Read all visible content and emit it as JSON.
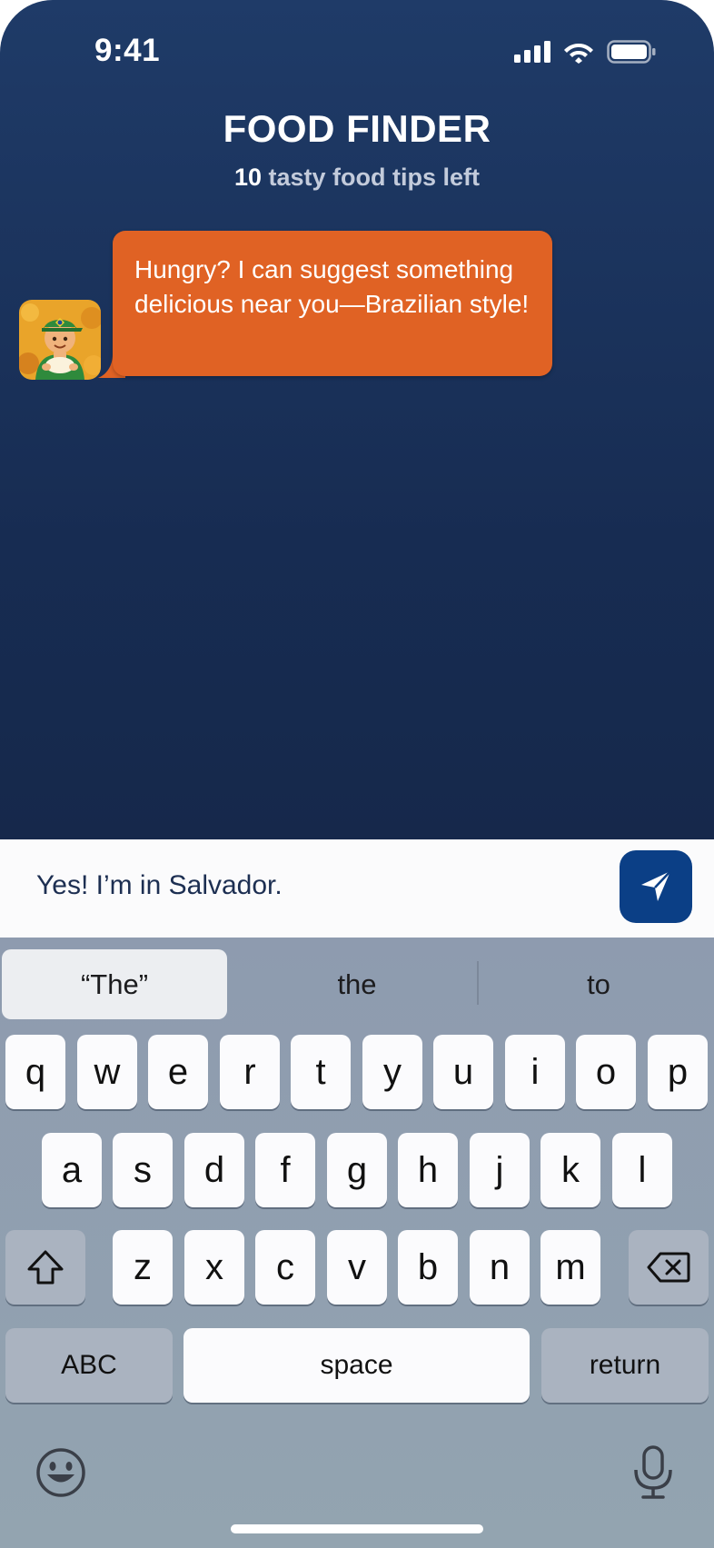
{
  "status": {
    "time": "9:41"
  },
  "header": {
    "title": "FOOD FINDER",
    "subtitle_count": "10",
    "subtitle_text": " tasty food tips left"
  },
  "chat": {
    "bot_message": "Hungry? I can suggest something delicious near you—Brazilian style!"
  },
  "input": {
    "value": "Yes! I’m in Salvador."
  },
  "keyboard": {
    "suggestions": [
      "“The”",
      "the",
      "to"
    ],
    "row1": [
      "q",
      "w",
      "e",
      "r",
      "t",
      "y",
      "u",
      "i",
      "o",
      "p"
    ],
    "row2": [
      "a",
      "s",
      "d",
      "f",
      "g",
      "h",
      "j",
      "k",
      "l"
    ],
    "row3": [
      "z",
      "x",
      "c",
      "v",
      "b",
      "n",
      "m"
    ],
    "abc_label": "ABC",
    "space_label": "space",
    "return_label": "return"
  },
  "colors": {
    "bubble": "#e06224",
    "send_button": "#0b3f86",
    "background_top": "#1f3b68",
    "background_bottom": "#121f3a"
  },
  "icons": [
    "signal-icon",
    "wifi-icon",
    "battery-icon",
    "send-icon",
    "shift-icon",
    "backspace-icon",
    "emoji-icon",
    "microphone-icon"
  ]
}
